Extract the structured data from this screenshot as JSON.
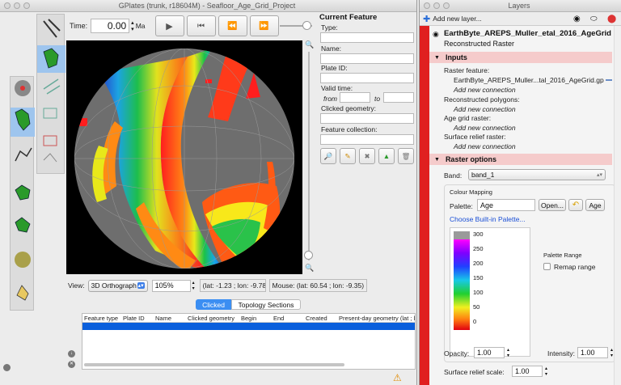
{
  "main_window": {
    "title": "GPlates (trunk, r18604M) - Seafloor_Age_Grid_Project",
    "time_label": "Time:",
    "time_value": "0.00",
    "time_unit": "Ma",
    "view_label": "View:",
    "projection": "3D Orthograph",
    "zoom": "105%",
    "camera_coords": "(lat: -1.23 ; lon: -9.78",
    "mouse_coords": "Mouse: (lat: 60.54 ; lon: -9.35)"
  },
  "current_feature": {
    "header": "Current Feature",
    "type_label": "Type:",
    "name_label": "Name:",
    "plate_id_label": "Plate ID:",
    "valid_time_label": "Valid time:",
    "from_label": "from",
    "to_label": "to",
    "clicked_geometry_label": "Clicked geometry:",
    "feature_collection_label": "Feature collection:"
  },
  "bottom_panel": {
    "tabs": [
      "Clicked",
      "Topology Sections"
    ],
    "columns": [
      "Feature type",
      "Plate ID",
      "Name",
      "Clicked geometry",
      "Begin",
      "End",
      "Created",
      "Present-day geometry (lat ; l"
    ]
  },
  "layers_window": {
    "title": "Layers",
    "add_layer": "Add new layer...",
    "layer_name": "EarthByte_AREPS_Muller_etal_2016_AgeGrid",
    "layer_type": "Reconstructed Raster",
    "inputs_header": "Inputs",
    "raster_feature_label": "Raster feature:",
    "raster_feature_value": "EarthByte_AREPS_Muller...tal_2016_AgeGrid.gp",
    "add_connection": "Add new connection",
    "reconstructed_polygons_label": "Reconstructed polygons:",
    "age_grid_raster_label": "Age grid raster:",
    "surface_relief_raster_label": "Surface relief raster:",
    "raster_options_header": "Raster options",
    "band_label": "Band:",
    "band_value": "band_1",
    "colour_mapping_label": "Colour Mapping",
    "palette_label": "Palette:",
    "palette_value": "Age",
    "open_button": "Open...",
    "age_button": "Age",
    "builtin_palette_link": "Choose Built-in Palette...",
    "palette_range_label": "Palette Range",
    "remap_range_label": "Remap range",
    "palette_ticks": [
      "300",
      "250",
      "200",
      "150",
      "100",
      "50",
      "0"
    ],
    "opacity_label": "Opacity:",
    "opacity_value": "1.00",
    "intensity_label": "Intensity:",
    "intensity_value": "1.00",
    "surface_relief_scale_label": "Surface relief scale:",
    "surface_relief_scale_value": "1.00"
  },
  "colors": {
    "header_pink": "#f5cbcb",
    "selection_blue": "#0a5fdc",
    "link_blue": "#1a4fd6",
    "globe_background": "#000000"
  }
}
